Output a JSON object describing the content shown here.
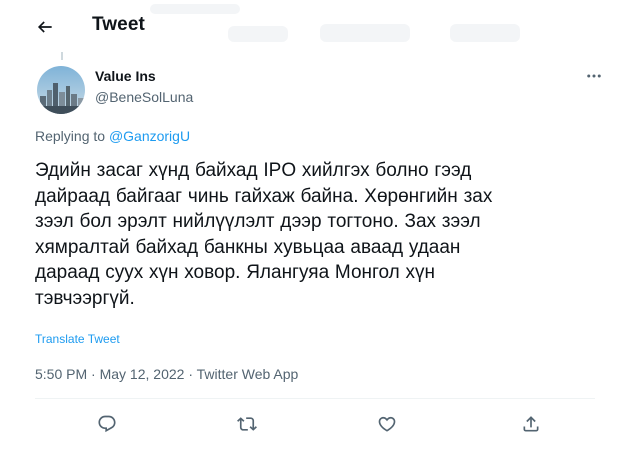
{
  "header": {
    "title": "Tweet",
    "back_icon": "arrow-left-icon"
  },
  "author": {
    "name": "Value Ins",
    "handle": "@BeneSolLuna",
    "more_icon": "more-horizontal-icon"
  },
  "replying": {
    "prefix": "Replying to ",
    "handle": "@GanzorigU"
  },
  "tweet": {
    "text": "Эдийн засаг хүнд байхад IPO хийлгэх болно гээд\nдайраад байгааг чинь гайхаж байна. Хөрөнгийн зах\nзээл бол эрэлт нийлүүлэлт дээр тогтоно. Зах зээл\nхямралтай байхад банкны хувьцаа аваад удаан\nдараад суух хүн ховор. Ялангуяа Монгол хүн\nтэвчээргүй.",
    "translate_label": "Translate Tweet",
    "time": "5:50 PM",
    "separator": " · ",
    "date": "May 12, 2022",
    "source": "Twitter Web App"
  },
  "actions": [
    {
      "name": "reply",
      "icon": "reply-icon"
    },
    {
      "name": "retweet",
      "icon": "retweet-icon"
    },
    {
      "name": "like",
      "icon": "heart-icon"
    },
    {
      "name": "share",
      "icon": "share-icon"
    }
  ],
  "colors": {
    "accent": "#1d9bf0",
    "text": "#0f1419",
    "secondary": "#536471"
  }
}
